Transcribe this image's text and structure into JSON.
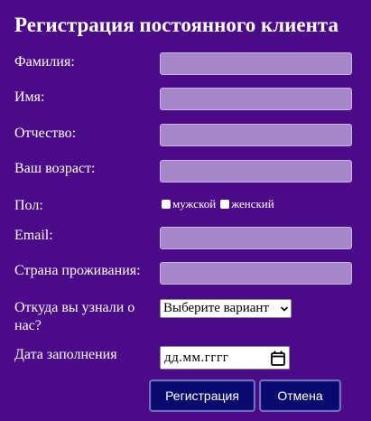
{
  "form": {
    "title": "Регистрация постоянного клиента",
    "fields": {
      "last_name": {
        "label": "Фамилия:",
        "value": ""
      },
      "first_name": {
        "label": "Имя:",
        "value": ""
      },
      "patronymic": {
        "label": "Отчество:",
        "value": ""
      },
      "age": {
        "label": "Ваш возраст:",
        "value": ""
      },
      "gender": {
        "label": "Пол:",
        "options": [
          "мужской",
          "женский"
        ]
      },
      "email": {
        "label": "Email:",
        "value": ""
      },
      "country": {
        "label": "Страна проживания:",
        "value": ""
      },
      "source": {
        "label_line1": "Откуда вы узнали о",
        "label_line2": "нас?",
        "selected": "Выберите вариант"
      },
      "date": {
        "label": "Дата заполнения",
        "placeholder": "дд.мм.гггг"
      }
    },
    "buttons": {
      "register": "Регистрация",
      "cancel": "Отмена"
    }
  },
  "colors": {
    "background": "#4b0a87",
    "input_fill": "#a586c9",
    "button_fill": "#0a0a6e",
    "text": "#ffffff"
  },
  "icons": {
    "select_arrow": "chevron-down-icon",
    "date_picker": "calendar-icon",
    "checkbox": "checkbox-icon"
  }
}
